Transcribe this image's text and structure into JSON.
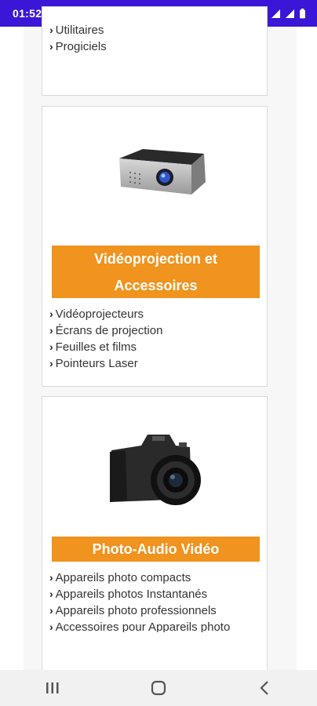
{
  "status_bar": {
    "time": "01:52",
    "left_icons": [
      "image-icon",
      "at-icon",
      "app-icon",
      "dot-icon"
    ],
    "right_icons": [
      "key-icon",
      "alarm-icon",
      "wifi-icon",
      "signal-icon",
      "signal-icon",
      "battery-icon"
    ]
  },
  "cards": [
    {
      "id": "software",
      "items": [
        "Utilitaires",
        "Progiciels"
      ]
    },
    {
      "id": "videoprojection",
      "title": "Vidéoprojection et Accessoires",
      "image": "projector-image",
      "items": [
        "Vidéoprojecteurs",
        "Écrans de projection",
        "Feuilles et films",
        "Pointeurs Laser"
      ]
    },
    {
      "id": "photo",
      "title": "Photo-Audio Vidéo",
      "image": "camera-image",
      "items": [
        "Appareils photo compacts",
        "Appareils photos Instantanés",
        "Appareils photo professionnels",
        "Accessoires pour Appareils photo"
      ]
    }
  ],
  "nav": {
    "buttons": [
      "recent-apps-icon",
      "home-icon",
      "back-icon"
    ]
  },
  "colors": {
    "status_bar": "#3b16d6",
    "banner": "#f0931f"
  }
}
